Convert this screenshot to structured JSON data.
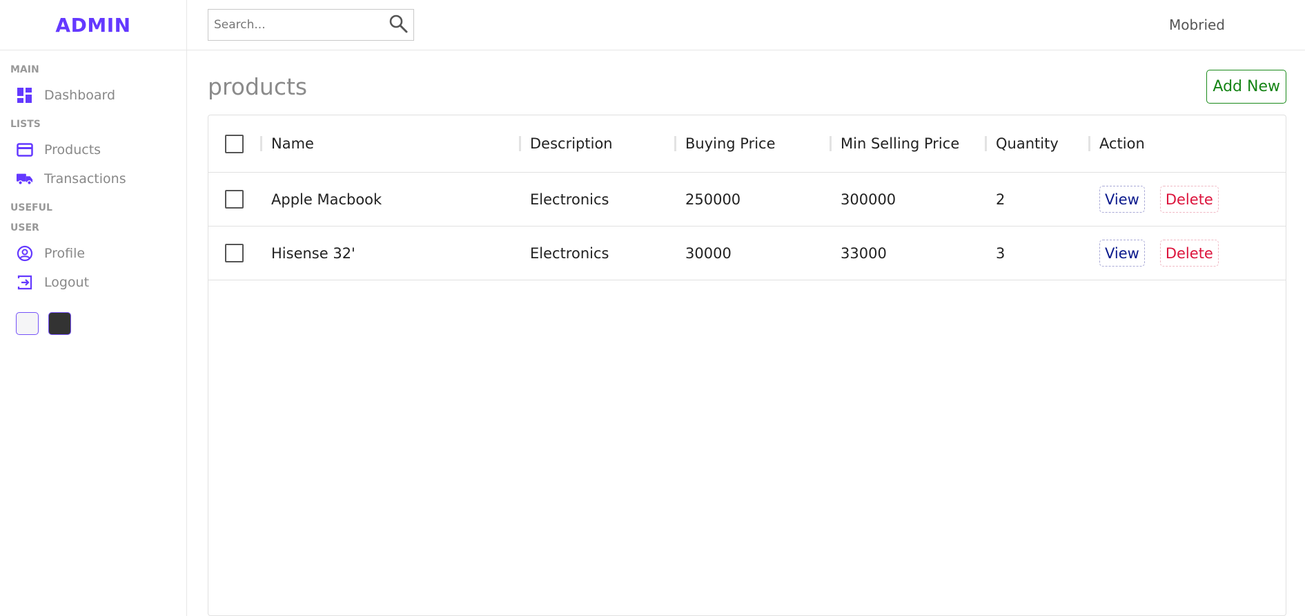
{
  "brand": {
    "logo": "ADMIN",
    "accent": "#6439ff"
  },
  "sidebar": {
    "sections": [
      {
        "title": "MAIN",
        "items": [
          {
            "label": "Dashboard",
            "icon": "dashboard-icon"
          }
        ]
      },
      {
        "title": "LISTS",
        "items": [
          {
            "label": "Products",
            "icon": "credit-card-icon"
          },
          {
            "label": "Transactions",
            "icon": "truck-icon"
          }
        ]
      },
      {
        "title": "USEFUL",
        "items": []
      },
      {
        "title": "USER",
        "items": [
          {
            "label": "Profile",
            "icon": "profile-icon"
          },
          {
            "label": "Logout",
            "icon": "logout-icon"
          }
        ]
      }
    ],
    "themes": [
      {
        "name": "light",
        "color": "#f5f5f7"
      },
      {
        "name": "dark",
        "color": "#333333"
      }
    ]
  },
  "topbar": {
    "search_placeholder": "Search...",
    "user": "Mobried"
  },
  "page": {
    "title": "products",
    "add_label": "Add New"
  },
  "table": {
    "columns": [
      "Name",
      "Description",
      "Buying Price",
      "Min Selling Price",
      "Quantity",
      "Action"
    ],
    "rows": [
      {
        "name": "Apple Macbook",
        "description": "Electronics",
        "buying_price": "250000",
        "min_selling_price": "300000",
        "quantity": "2"
      },
      {
        "name": "Hisense 32'",
        "description": "Electronics",
        "buying_price": "30000",
        "min_selling_price": "33000",
        "quantity": "3"
      }
    ],
    "actions": {
      "view": "View",
      "delete": "Delete"
    }
  }
}
